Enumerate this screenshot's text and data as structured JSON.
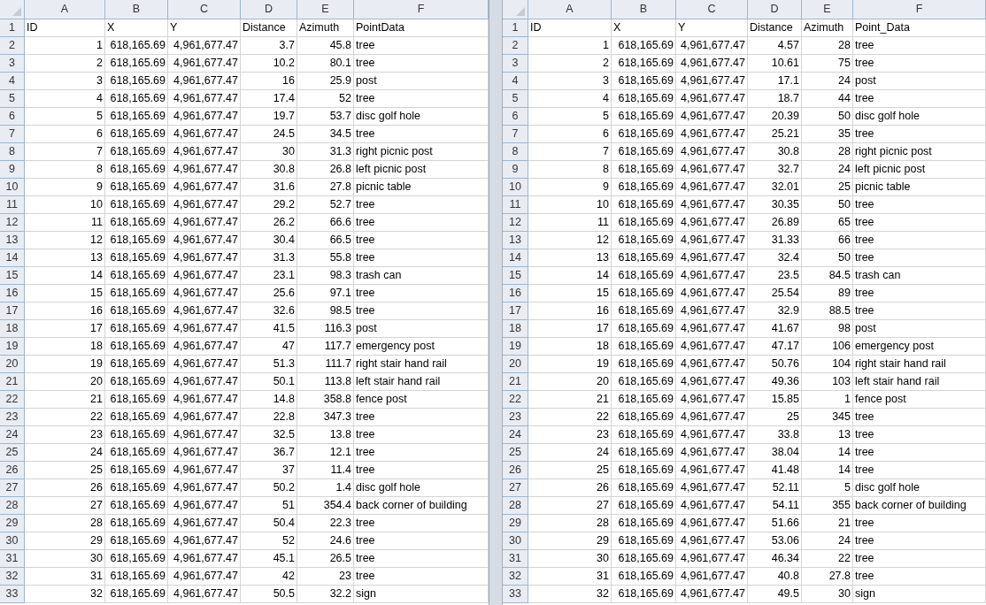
{
  "sheets": [
    {
      "columns": [
        "A",
        "B",
        "C",
        "D",
        "E",
        "F"
      ],
      "rows": [
        {
          "number": "1",
          "kind": "labels",
          "cells": [
            "ID",
            "X",
            "Y",
            "Distance",
            "Azimuth",
            "PointData"
          ]
        },
        {
          "number": "2",
          "kind": "records",
          "cells": [
            "1",
            "618,165.69",
            "4,961,677.47",
            "3.7",
            "45.8",
            "tree"
          ]
        },
        {
          "number": "3",
          "kind": "records",
          "cells": [
            "2",
            "618,165.69",
            "4,961,677.47",
            "10.2",
            "80.1",
            "tree"
          ]
        },
        {
          "number": "4",
          "kind": "records",
          "cells": [
            "3",
            "618,165.69",
            "4,961,677.47",
            "16",
            "25.9",
            "post"
          ]
        },
        {
          "number": "5",
          "kind": "records",
          "cells": [
            "4",
            "618,165.69",
            "4,961,677.47",
            "17.4",
            "52",
            "tree"
          ]
        },
        {
          "number": "6",
          "kind": "records",
          "cells": [
            "5",
            "618,165.69",
            "4,961,677.47",
            "19.7",
            "53.7",
            "disc golf hole"
          ]
        },
        {
          "number": "7",
          "kind": "records",
          "cells": [
            "6",
            "618,165.69",
            "4,961,677.47",
            "24.5",
            "34.5",
            "tree"
          ]
        },
        {
          "number": "8",
          "kind": "records",
          "cells": [
            "7",
            "618,165.69",
            "4,961,677.47",
            "30",
            "31.3",
            "right picnic post"
          ]
        },
        {
          "number": "9",
          "kind": "records",
          "cells": [
            "8",
            "618,165.69",
            "4,961,677.47",
            "30.8",
            "26.8",
            "left picnic post"
          ]
        },
        {
          "number": "10",
          "kind": "records",
          "cells": [
            "9",
            "618,165.69",
            "4,961,677.47",
            "31.6",
            "27.8",
            "picnic table"
          ]
        },
        {
          "number": "11",
          "kind": "records",
          "cells": [
            "10",
            "618,165.69",
            "4,961,677.47",
            "29.2",
            "52.7",
            "tree"
          ]
        },
        {
          "number": "12",
          "kind": "records",
          "cells": [
            "11",
            "618,165.69",
            "4,961,677.47",
            "26.2",
            "66.6",
            "tree"
          ]
        },
        {
          "number": "13",
          "kind": "records",
          "cells": [
            "12",
            "618,165.69",
            "4,961,677.47",
            "30.4",
            "66.5",
            "tree"
          ]
        },
        {
          "number": "14",
          "kind": "records",
          "cells": [
            "13",
            "618,165.69",
            "4,961,677.47",
            "31.3",
            "55.8",
            "tree"
          ]
        },
        {
          "number": "15",
          "kind": "records",
          "cells": [
            "14",
            "618,165.69",
            "4,961,677.47",
            "23.1",
            "98.3",
            "trash can"
          ]
        },
        {
          "number": "16",
          "kind": "records",
          "cells": [
            "15",
            "618,165.69",
            "4,961,677.47",
            "25.6",
            "97.1",
            "tree"
          ]
        },
        {
          "number": "17",
          "kind": "records",
          "cells": [
            "16",
            "618,165.69",
            "4,961,677.47",
            "32.6",
            "98.5",
            "tree"
          ]
        },
        {
          "number": "18",
          "kind": "records",
          "cells": [
            "17",
            "618,165.69",
            "4,961,677.47",
            "41.5",
            "116.3",
            "post"
          ]
        },
        {
          "number": "19",
          "kind": "records",
          "cells": [
            "18",
            "618,165.69",
            "4,961,677.47",
            "47",
            "117.7",
            "emergency post"
          ]
        },
        {
          "number": "20",
          "kind": "records",
          "cells": [
            "19",
            "618,165.69",
            "4,961,677.47",
            "51.3",
            "111.7",
            "right stair hand rail"
          ]
        },
        {
          "number": "21",
          "kind": "records",
          "cells": [
            "20",
            "618,165.69",
            "4,961,677.47",
            "50.1",
            "113.8",
            "left stair hand rail"
          ]
        },
        {
          "number": "22",
          "kind": "records",
          "cells": [
            "21",
            "618,165.69",
            "4,961,677.47",
            "14.8",
            "358.8",
            "fence post"
          ]
        },
        {
          "number": "23",
          "kind": "records",
          "cells": [
            "22",
            "618,165.69",
            "4,961,677.47",
            "22.8",
            "347.3",
            "tree"
          ]
        },
        {
          "number": "24",
          "kind": "records",
          "cells": [
            "23",
            "618,165.69",
            "4,961,677.47",
            "32.5",
            "13.8",
            "tree"
          ]
        },
        {
          "number": "25",
          "kind": "records",
          "cells": [
            "24",
            "618,165.69",
            "4,961,677.47",
            "36.7",
            "12.1",
            "tree"
          ]
        },
        {
          "number": "26",
          "kind": "records",
          "cells": [
            "25",
            "618,165.69",
            "4,961,677.47",
            "37",
            "11.4",
            "tree"
          ]
        },
        {
          "number": "27",
          "kind": "records",
          "cells": [
            "26",
            "618,165.69",
            "4,961,677.47",
            "50.2",
            "1.4",
            "disc golf hole"
          ]
        },
        {
          "number": "28",
          "kind": "records",
          "cells": [
            "27",
            "618,165.69",
            "4,961,677.47",
            "51",
            "354.4",
            "back corner of building"
          ]
        },
        {
          "number": "29",
          "kind": "records",
          "cells": [
            "28",
            "618,165.69",
            "4,961,677.47",
            "50.4",
            "22.3",
            "tree"
          ]
        },
        {
          "number": "30",
          "kind": "records",
          "cells": [
            "29",
            "618,165.69",
            "4,961,677.47",
            "52",
            "24.6",
            "tree"
          ]
        },
        {
          "number": "31",
          "kind": "records",
          "cells": [
            "30",
            "618,165.69",
            "4,961,677.47",
            "45.1",
            "26.5",
            "tree"
          ]
        },
        {
          "number": "32",
          "kind": "records",
          "cells": [
            "31",
            "618,165.69",
            "4,961,677.47",
            "42",
            "23",
            "tree"
          ]
        },
        {
          "number": "33",
          "kind": "records",
          "cells": [
            "32",
            "618,165.69",
            "4,961,677.47",
            "50.5",
            "32.2",
            "sign"
          ]
        }
      ]
    },
    {
      "columns": [
        "A",
        "B",
        "C",
        "D",
        "E",
        "F"
      ],
      "rows": [
        {
          "number": "1",
          "kind": "labels",
          "cells": [
            "ID",
            "X",
            "Y",
            "Distance",
            "Azimuth",
            "Point_Data"
          ]
        },
        {
          "number": "2",
          "kind": "records",
          "cells": [
            "1",
            "618,165.69",
            "4,961,677.47",
            "4.57",
            "28",
            "tree"
          ]
        },
        {
          "number": "3",
          "kind": "records",
          "cells": [
            "2",
            "618,165.69",
            "4,961,677.47",
            "10.61",
            "75",
            "tree"
          ]
        },
        {
          "number": "4",
          "kind": "records",
          "cells": [
            "3",
            "618,165.69",
            "4,961,677.47",
            "17.1",
            "24",
            "post"
          ]
        },
        {
          "number": "5",
          "kind": "records",
          "cells": [
            "4",
            "618,165.69",
            "4,961,677.47",
            "18.7",
            "44",
            "tree"
          ]
        },
        {
          "number": "6",
          "kind": "records",
          "cells": [
            "5",
            "618,165.69",
            "4,961,677.47",
            "20.39",
            "50",
            "disc golf hole"
          ]
        },
        {
          "number": "7",
          "kind": "records",
          "cells": [
            "6",
            "618,165.69",
            "4,961,677.47",
            "25.21",
            "35",
            "tree"
          ]
        },
        {
          "number": "8",
          "kind": "records",
          "cells": [
            "7",
            "618,165.69",
            "4,961,677.47",
            "30.8",
            "28",
            "right picnic post"
          ]
        },
        {
          "number": "9",
          "kind": "records",
          "cells": [
            "8",
            "618,165.69",
            "4,961,677.47",
            "32.7",
            "24",
            "left picnic post"
          ]
        },
        {
          "number": "10",
          "kind": "records",
          "cells": [
            "9",
            "618,165.69",
            "4,961,677.47",
            "32.01",
            "25",
            "picnic table"
          ]
        },
        {
          "number": "11",
          "kind": "records",
          "cells": [
            "10",
            "618,165.69",
            "4,961,677.47",
            "30.35",
            "50",
            "tree"
          ]
        },
        {
          "number": "12",
          "kind": "records",
          "cells": [
            "11",
            "618,165.69",
            "4,961,677.47",
            "26.89",
            "65",
            "tree"
          ]
        },
        {
          "number": "13",
          "kind": "records",
          "cells": [
            "12",
            "618,165.69",
            "4,961,677.47",
            "31.33",
            "66",
            "tree"
          ]
        },
        {
          "number": "14",
          "kind": "records",
          "cells": [
            "13",
            "618,165.69",
            "4,961,677.47",
            "32.4",
            "50",
            "tree"
          ]
        },
        {
          "number": "15",
          "kind": "records",
          "cells": [
            "14",
            "618,165.69",
            "4,961,677.47",
            "23.5",
            "84.5",
            "trash can"
          ]
        },
        {
          "number": "16",
          "kind": "records",
          "cells": [
            "15",
            "618,165.69",
            "4,961,677.47",
            "25.54",
            "89",
            "tree"
          ]
        },
        {
          "number": "17",
          "kind": "records",
          "cells": [
            "16",
            "618,165.69",
            "4,961,677.47",
            "32.9",
            "88.5",
            "tree"
          ]
        },
        {
          "number": "18",
          "kind": "records",
          "cells": [
            "17",
            "618,165.69",
            "4,961,677.47",
            "41.67",
            "98",
            "post"
          ]
        },
        {
          "number": "19",
          "kind": "records",
          "cells": [
            "18",
            "618,165.69",
            "4,961,677.47",
            "47.17",
            "106",
            "emergency post"
          ]
        },
        {
          "number": "20",
          "kind": "records",
          "cells": [
            "19",
            "618,165.69",
            "4,961,677.47",
            "50.76",
            "104",
            "right stair hand rail"
          ]
        },
        {
          "number": "21",
          "kind": "records",
          "cells": [
            "20",
            "618,165.69",
            "4,961,677.47",
            "49.36",
            "103",
            "left stair hand rail"
          ]
        },
        {
          "number": "22",
          "kind": "records",
          "cells": [
            "21",
            "618,165.69",
            "4,961,677.47",
            "15.85",
            "1",
            "fence post"
          ]
        },
        {
          "number": "23",
          "kind": "records",
          "cells": [
            "22",
            "618,165.69",
            "4,961,677.47",
            "25",
            "345",
            "tree"
          ]
        },
        {
          "number": "24",
          "kind": "records",
          "cells": [
            "23",
            "618,165.69",
            "4,961,677.47",
            "33.8",
            "13",
            "tree"
          ]
        },
        {
          "number": "25",
          "kind": "records",
          "cells": [
            "24",
            "618,165.69",
            "4,961,677.47",
            "38.04",
            "14",
            "tree"
          ]
        },
        {
          "number": "26",
          "kind": "records",
          "cells": [
            "25",
            "618,165.69",
            "4,961,677.47",
            "41.48",
            "14",
            "tree"
          ]
        },
        {
          "number": "27",
          "kind": "records",
          "cells": [
            "26",
            "618,165.69",
            "4,961,677.47",
            "52.11",
            "5",
            "disc golf hole"
          ]
        },
        {
          "number": "28",
          "kind": "records",
          "cells": [
            "27",
            "618,165.69",
            "4,961,677.47",
            "54.11",
            "355",
            "back corner of building"
          ]
        },
        {
          "number": "29",
          "kind": "records",
          "cells": [
            "28",
            "618,165.69",
            "4,961,677.47",
            "51.66",
            "21",
            "tree"
          ]
        },
        {
          "number": "30",
          "kind": "records",
          "cells": [
            "29",
            "618,165.69",
            "4,961,677.47",
            "53.06",
            "24",
            "tree"
          ]
        },
        {
          "number": "31",
          "kind": "records",
          "cells": [
            "30",
            "618,165.69",
            "4,961,677.47",
            "46.34",
            "22",
            "tree"
          ]
        },
        {
          "number": "32",
          "kind": "records",
          "cells": [
            "31",
            "618,165.69",
            "4,961,677.47",
            "40.8",
            "27.8",
            "tree"
          ]
        },
        {
          "number": "33",
          "kind": "records",
          "cells": [
            "32",
            "618,165.69",
            "4,961,677.47",
            "49.5",
            "30",
            "sign"
          ]
        }
      ]
    }
  ]
}
